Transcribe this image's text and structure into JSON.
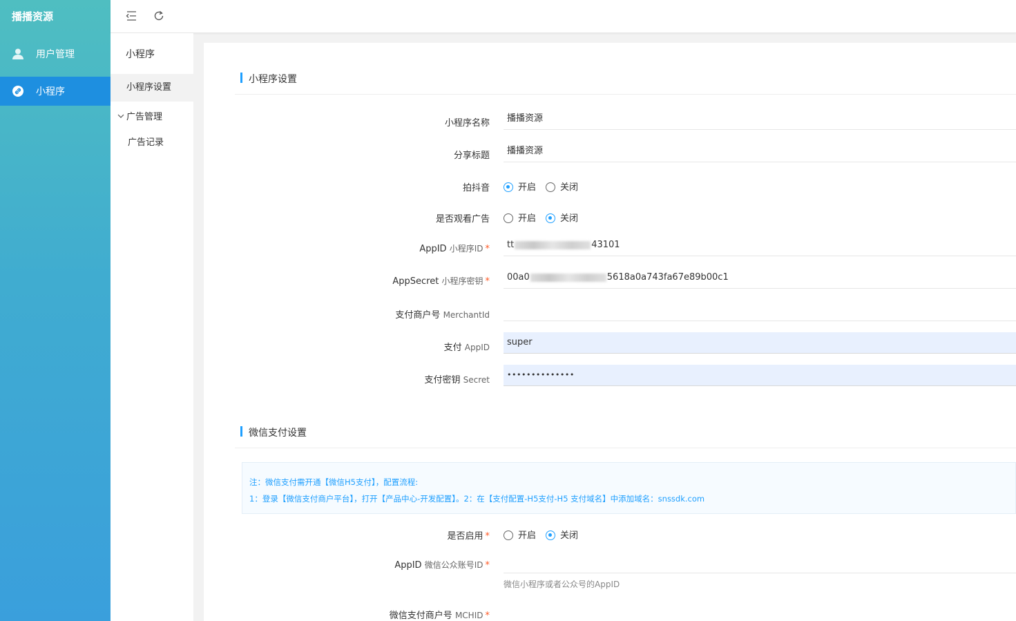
{
  "sidebar": {
    "brand": "播播资源",
    "items": [
      {
        "label": "用户管理",
        "icon": "user-icon"
      },
      {
        "label": "小程序",
        "icon": "link-icon"
      }
    ]
  },
  "submenu": {
    "title": "小程序",
    "items": [
      {
        "label": "小程序设置"
      },
      {
        "label": "广告管理"
      },
      {
        "label": "广告记录"
      }
    ]
  },
  "topbar": {
    "icons": [
      "menu-fold-icon",
      "refresh-icon"
    ]
  },
  "colors": {
    "accent": "#1e9fff",
    "active_menu": "#1e8fe0",
    "required": "#ff5722"
  },
  "miniapp_section": {
    "title": "小程序设置",
    "fields": {
      "name": {
        "label": "小程序名称",
        "value": "播播资源"
      },
      "share_title": {
        "label": "分享标题",
        "value": "播播资源"
      },
      "douyin": {
        "label": "拍抖音",
        "options": [
          "开启",
          "关闭"
        ],
        "selected": "开启"
      },
      "watch_ad": {
        "label": "是否观看广告",
        "options": [
          "开启",
          "关闭"
        ],
        "selected": "关闭"
      },
      "appid": {
        "label": "AppID",
        "label_en": "小程序ID",
        "required": "*",
        "value_prefix": "tt",
        "value_suffix": "43101"
      },
      "appsecret": {
        "label": "AppSecret",
        "label_en": "小程序密钥",
        "required": "*",
        "value_prefix": "00a0",
        "value_suffix": "5618a0a743fa67e89b00c1"
      },
      "merchant": {
        "label": "支付商户号",
        "label_en": "MerchantId",
        "value": ""
      },
      "pay_appid": {
        "label": "支付",
        "label_en": "AppID",
        "value": "super"
      },
      "pay_secret": {
        "label": "支付密钥",
        "label_en": "Secret",
        "value": "••••••••••••••"
      }
    }
  },
  "wechat_section": {
    "title": "微信支付设置",
    "notice_line1": "注：微信支付需开通【微信H5支付】，配置流程:",
    "notice_line2": "1：登录【微信支付商户平台】，打开【产品中心-开发配置】。2：在【支付配置-H5支付-H5 支付域名】中添加域名：snssdk.com",
    "fields": {
      "enabled": {
        "label": "是否启用",
        "required": "*",
        "options": [
          "开启",
          "关闭"
        ],
        "selected": "关闭"
      },
      "appid": {
        "label": "AppID",
        "label_en": "微信公众账号ID",
        "required": "*",
        "value": "",
        "help": "微信小程序或者公众号的AppID"
      },
      "mchid": {
        "label": "微信支付商户号",
        "label_en": "MCHID",
        "required": "*"
      }
    }
  }
}
